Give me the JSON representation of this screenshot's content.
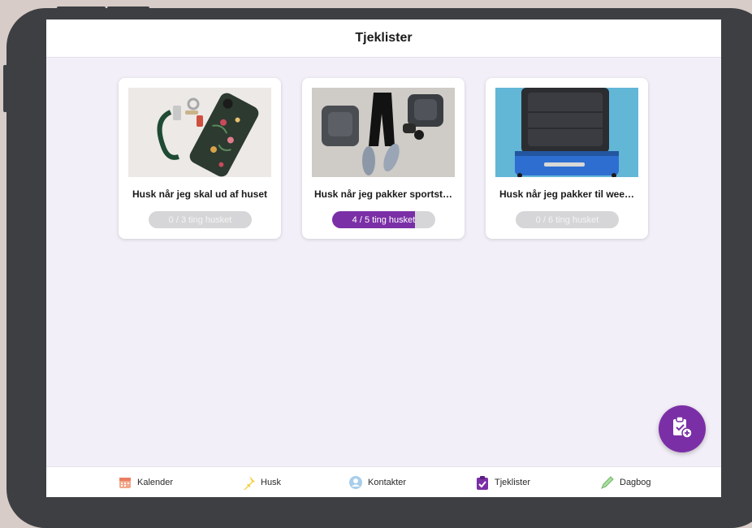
{
  "header": {
    "title": "Tjeklister"
  },
  "cards": [
    {
      "title": "Husk når jeg skal ud af huset",
      "progress_text": "0 / 3 ting husket",
      "done": 0,
      "total": 3,
      "image": "keys-and-phone"
    },
    {
      "title": "Husk når jeg pakker sportst…",
      "progress_text": "4 / 5 ting husket",
      "done": 4,
      "total": 5,
      "image": "sports-clothes"
    },
    {
      "title": "Husk når jeg pakker til wee…",
      "progress_text": "0 / 6 ting husket",
      "done": 0,
      "total": 6,
      "image": "open-suitcase"
    }
  ],
  "fab": {
    "icon": "add-checklist-icon"
  },
  "nav": {
    "items": [
      {
        "label": "Kalender",
        "icon": "calendar-icon"
      },
      {
        "label": "Husk",
        "icon": "pin-icon"
      },
      {
        "label": "Kontakter",
        "icon": "contact-icon"
      },
      {
        "label": "Tjeklister",
        "icon": "clipboard-check-icon"
      },
      {
        "label": "Dagbog",
        "icon": "pencil-icon"
      }
    ]
  },
  "colors": {
    "accent": "#7b2fa6",
    "background": "#f3eff8",
    "progress_track": "#d6d6d8"
  }
}
